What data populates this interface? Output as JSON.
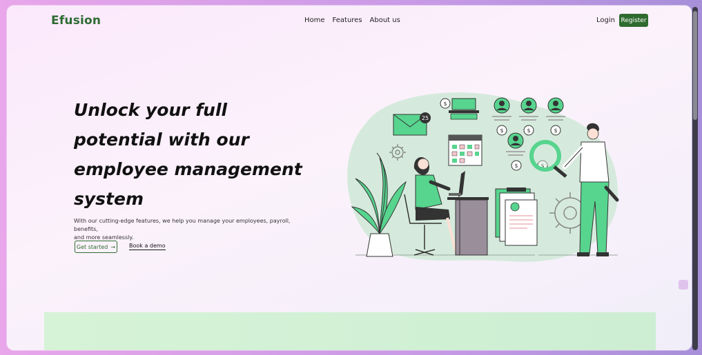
{
  "brand": {
    "name": "Efusion"
  },
  "nav": {
    "home": "Home",
    "features": "Features",
    "about": "About us"
  },
  "auth": {
    "login": "Login",
    "register": "Register"
  },
  "hero": {
    "title_lines": [
      "Unlock your full",
      "potential with our",
      "employee management",
      "system"
    ],
    "subtitle_lines": [
      "With our cutting-edge features, we help you manage your employees, payroll, benefits,",
      "and more seamlessly."
    ],
    "primary_cta": "Get started",
    "primary_cta_arrow": "→",
    "secondary_cta": "Book a demo"
  },
  "illustration": {
    "badge_count": "25",
    "currency_symbol": "$"
  },
  "colors": {
    "brand_green": "#2f6b33",
    "accent_green": "#57d48e",
    "blob": "#d5eadc",
    "section_green": "#d2f1d6"
  },
  "icons": [
    "arrow-right-icon",
    "envelope-icon",
    "gear-icon",
    "calendar-icon",
    "dollar-coin-icon",
    "user-avatar-icon",
    "magnifier-icon",
    "plant-icon",
    "chat-widget-icon"
  ]
}
